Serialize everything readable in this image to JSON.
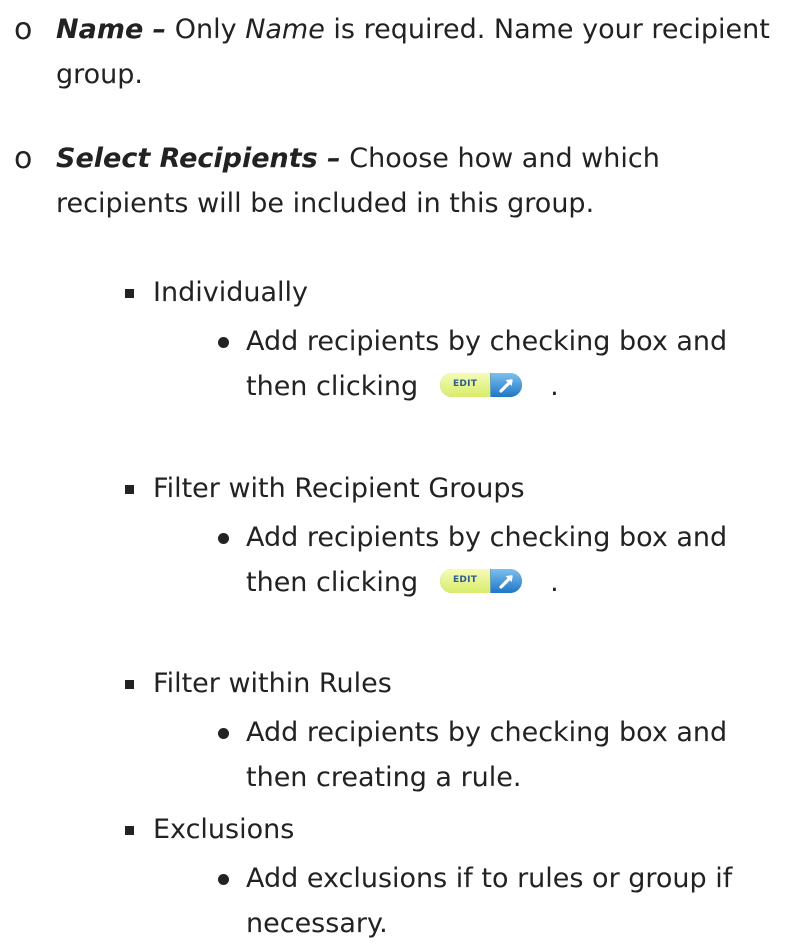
{
  "items": [
    {
      "bullet": "o",
      "term": "Name –",
      "text_before_italic": " Only ",
      "italic_word": "Name",
      "text_after_italic": " is required. Name your recipient group."
    },
    {
      "bullet": "o",
      "term": "Select Recipients –",
      "text": " Choose how and which recipients will be included in this group."
    }
  ],
  "sub_items": [
    {
      "label": "Individually",
      "detail_before": "Add recipients by checking box and then clicking",
      "detail_after": ".",
      "has_edit_button": true
    },
    {
      "label": "Filter with Recipient Groups",
      "detail_before": "Add recipients by checking box and then clicking",
      "detail_after": ".",
      "has_edit_button": true
    },
    {
      "label": "Filter within Rules",
      "detail": "Add recipients by checking box and then creating a rule."
    },
    {
      "label": "Exclusions",
      "detail": "Add exclusions if  to rules or group if necessary."
    }
  ],
  "edit_button": {
    "label": "EDIT",
    "icon": "diagonal-arrow-icon"
  },
  "colors": {
    "text": "#222222",
    "edit_label": "#2c5d8e",
    "edit_left_bg": "#e4f28a",
    "edit_right_bg": "#3a8fd6"
  }
}
